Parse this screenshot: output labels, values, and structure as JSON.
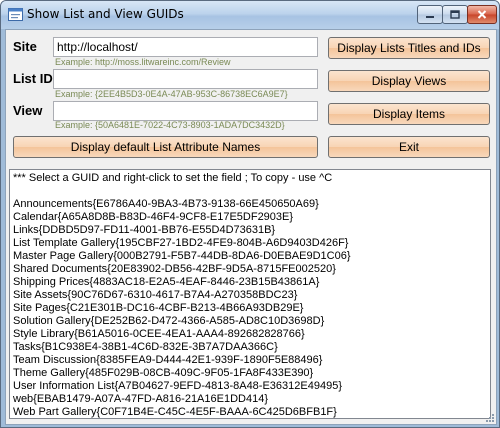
{
  "window": {
    "title": "Show List and View GUIDs"
  },
  "form": {
    "site_label": "Site",
    "site_value": "http://localhost/",
    "site_hint": "Example: http://moss.litwareinc.com/Review",
    "listid_label": "List ID",
    "listid_value": "",
    "listid_hint": "Example: {2EE4B5D3-0E4A-47AB-953C-86738EC6A9E7}",
    "view_label": "View",
    "view_value": "",
    "view_hint": "Example: {50A6481E-7022-4C73-8903-1ADA7DC3432D}"
  },
  "buttons": {
    "display_lists": "Display Lists Titles and IDs",
    "display_views": "Display Views",
    "display_items": "Display Items",
    "display_default": "Display default List Attribute Names",
    "exit": "Exit"
  },
  "output": {
    "lines": [
      "*** Select a GUID and right-click to set the field ; To copy - use ^C",
      "",
      "Announcements{E6786A40-9BA3-4B73-9138-66E450650A69}",
      "Calendar{A65A8D8B-B83D-46F4-9CF8-E17E5DF2903E}",
      "Links{DDBD5D97-FD11-4001-BB76-E55D4D73631B}",
      "List Template Gallery{195CBF27-1BD2-4FE9-804B-A6D9403D426F}",
      "Master Page Gallery{000B2791-F5B7-44DB-8DA6-D0EBAE9D1C06}",
      "Shared Documents{20E83902-DB56-42BF-9D5A-8715FE002520}",
      "Shipping Prices{4883AC18-E2A5-4EAF-8446-23B15B43861A}",
      "Site Assets{90C76D67-6310-4617-B7A4-A270358BDC23}",
      "Site Pages{C21E301B-DC16-4CBF-B213-4B66A93DB29E}",
      "Solution Gallery{DE252B62-D472-4366-A585-AD8C10D3698D}",
      "Style Library{B61A5016-0CEE-4EA1-AAA4-892682828766}",
      "Tasks{B1C938E4-38B1-4C6D-832E-3B7A7DAA366C}",
      "Team Discussion{8385FEA9-D444-42E1-939F-1890F5E88496}",
      "Theme Gallery{485F029B-08CB-409C-9F05-1FA8F433E390}",
      "User Information List{A7B04627-9EFD-4813-8A48-E36312E49495}",
      "web{EBAB1479-A07A-47FD-A816-21A16E1DD414}",
      "Web Part Gallery{C0F71B4E-C45C-4E5F-BAAA-6C425D6BFB1F}"
    ]
  }
}
